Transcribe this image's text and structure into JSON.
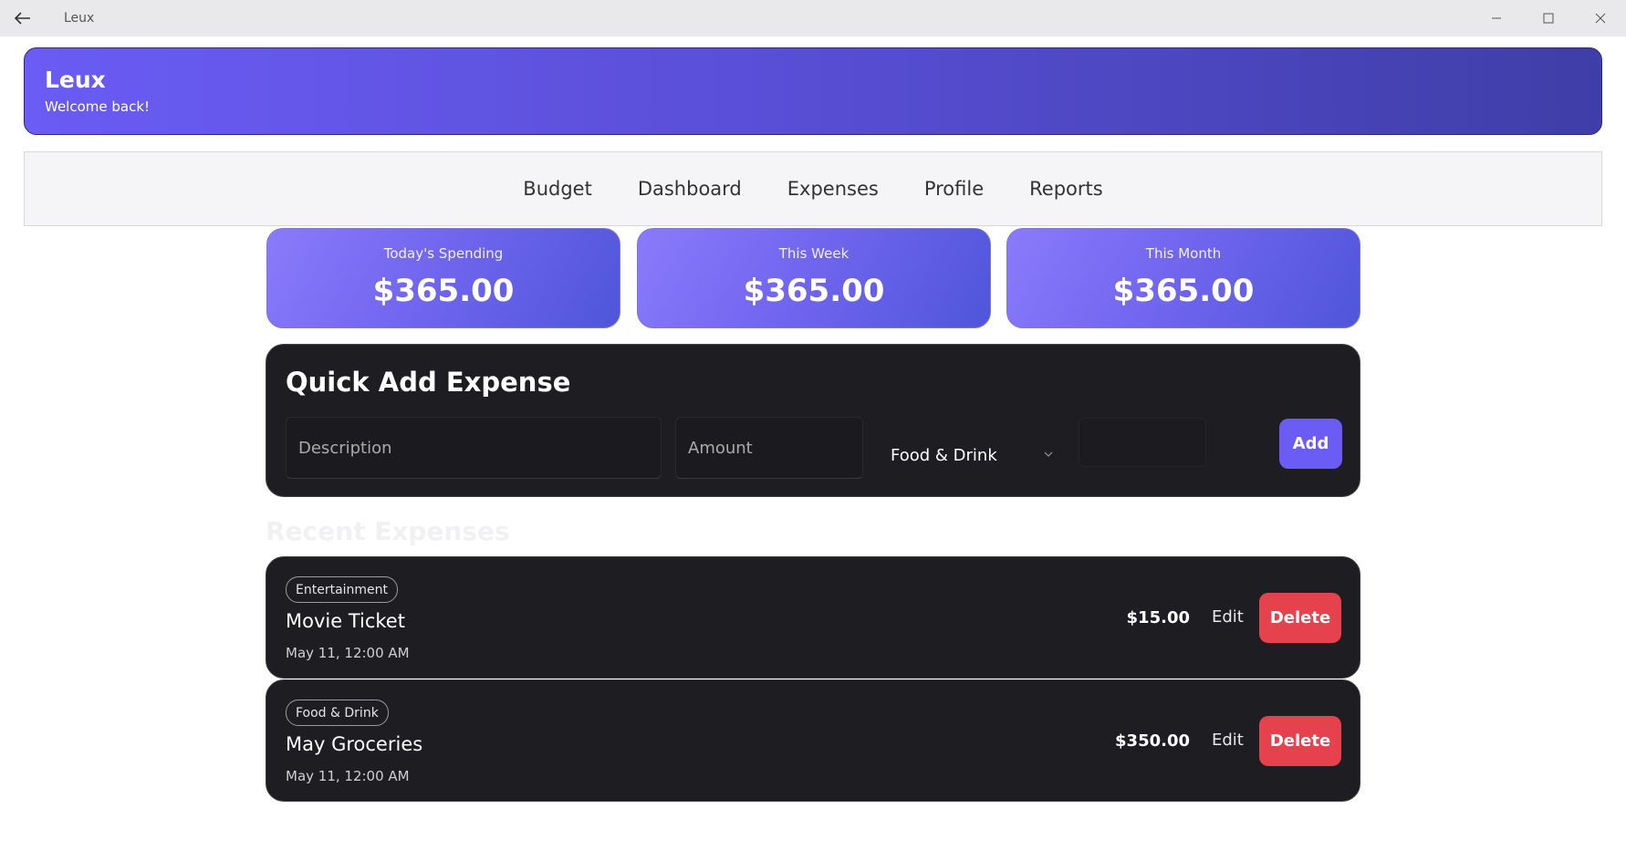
{
  "window": {
    "title": "Leux"
  },
  "header": {
    "title": "Leux",
    "subtitle": "Welcome back!"
  },
  "nav": {
    "items": [
      "Budget",
      "Dashboard",
      "Expenses",
      "Profile",
      "Reports"
    ]
  },
  "stats": [
    {
      "label": "Today's Spending",
      "value": "$365.00"
    },
    {
      "label": "This Week",
      "value": "$365.00"
    },
    {
      "label": "This Month",
      "value": "$365.00"
    }
  ],
  "quick_add": {
    "title": "Quick Add Expense",
    "description_placeholder": "Description",
    "amount_placeholder": "Amount",
    "category_value": "Food & Drink",
    "add_label": "Add"
  },
  "recent": {
    "title": "Recent Expenses",
    "items": [
      {
        "category": "Entertainment",
        "name": "Movie Ticket",
        "date": "May 11, 12:00 AM",
        "amount": "$15.00",
        "edit_label": "Edit",
        "delete_label": "Delete"
      },
      {
        "category": "Food & Drink",
        "name": "May Groceries",
        "date": "May 11, 12:00 AM",
        "amount": "$350.00",
        "edit_label": "Edit",
        "delete_label": "Delete"
      }
    ]
  },
  "colors": {
    "accent": "#6c5cf6",
    "danger": "#e5424d",
    "card_dark": "#1e1e22"
  }
}
